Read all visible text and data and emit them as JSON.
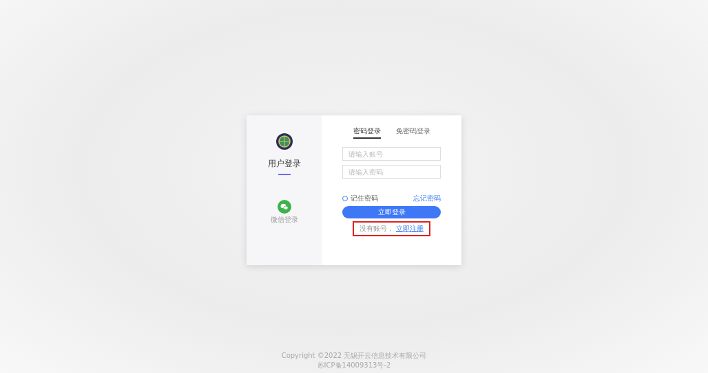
{
  "brand": {
    "title": "用户登录",
    "wechat_label": "微信登录"
  },
  "tabs": [
    {
      "label": "密码登录",
      "selected": true
    },
    {
      "label": "免密码登录",
      "selected": false
    }
  ],
  "fields": [
    {
      "placeholder": "请输入账号"
    },
    {
      "placeholder": "请输入密码"
    }
  ],
  "remember": {
    "label": "记住密码",
    "checked": false
  },
  "forgot_link": "忘记密码",
  "login_button": "立即登录",
  "register": {
    "prompt": "没有账号，",
    "link": "立即注册",
    "highlighted": true
  },
  "footer": [
    "Copyright ©2022 无锡开云信息技术有限公司",
    "苏ICP备14009313号-2"
  ]
}
